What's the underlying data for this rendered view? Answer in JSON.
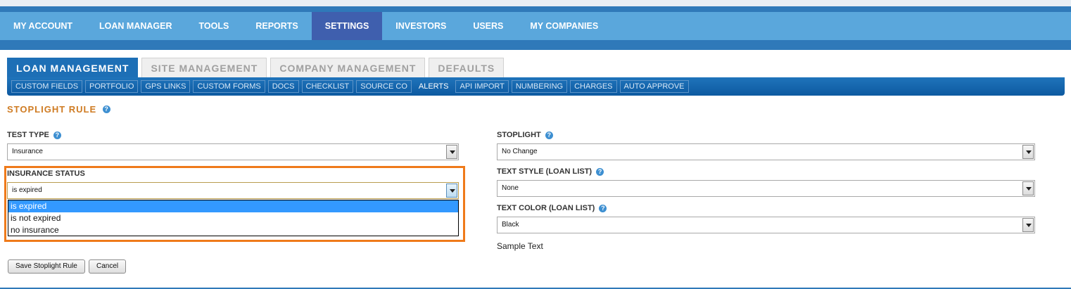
{
  "main_nav": [
    {
      "label": "MY ACCOUNT"
    },
    {
      "label": "LOAN MANAGER"
    },
    {
      "label": "TOOLS"
    },
    {
      "label": "REPORTS"
    },
    {
      "label": "SETTINGS",
      "active": true
    },
    {
      "label": "INVESTORS"
    },
    {
      "label": "USERS"
    },
    {
      "label": "MY COMPANIES"
    }
  ],
  "tabs": [
    {
      "label": "LOAN MANAGEMENT",
      "active": true
    },
    {
      "label": "SITE MANAGEMENT"
    },
    {
      "label": "COMPANY MANAGEMENT"
    },
    {
      "label": "DEFAULTS"
    }
  ],
  "sub_nav": [
    {
      "label": "CUSTOM FIELDS"
    },
    {
      "label": "PORTFOLIO"
    },
    {
      "label": "GPS LINKS"
    },
    {
      "label": "CUSTOM FORMS"
    },
    {
      "label": "DOCS"
    },
    {
      "label": "CHECKLIST"
    },
    {
      "label": "SOURCE CO"
    },
    {
      "label": "ALERTS",
      "active": true
    },
    {
      "label": "API IMPORT"
    },
    {
      "label": "NUMBERING"
    },
    {
      "label": "CHARGES"
    },
    {
      "label": "AUTO APPROVE"
    }
  ],
  "page_title": "STOPLIGHT RULE",
  "help_glyph": "?",
  "form": {
    "test_type": {
      "label": "TEST TYPE",
      "value": "Insurance"
    },
    "insurance_status": {
      "label": "INSURANCE STATUS",
      "value": "is expired",
      "options": [
        "is expired",
        "is not expired",
        "no insurance"
      ],
      "selected_index": 0
    },
    "stoplight": {
      "label": "STOPLIGHT",
      "value": "No Change"
    },
    "text_style": {
      "label": "TEXT STYLE (LOAN LIST)",
      "value": "None"
    },
    "text_color": {
      "label": "TEXT COLOR (LOAN LIST)",
      "value": "Black"
    },
    "sample_text": "Sample Text"
  },
  "buttons": {
    "save": "Save Stoplight Rule",
    "cancel": "Cancel"
  },
  "colors": {
    "nav_bar": "#5aa7dc",
    "nav_active": "#3f5fae",
    "tab_active": "#1d6fb6",
    "title": "#cf7b22",
    "highlight": "#ef7a1a",
    "option_selected": "#3399ff"
  }
}
